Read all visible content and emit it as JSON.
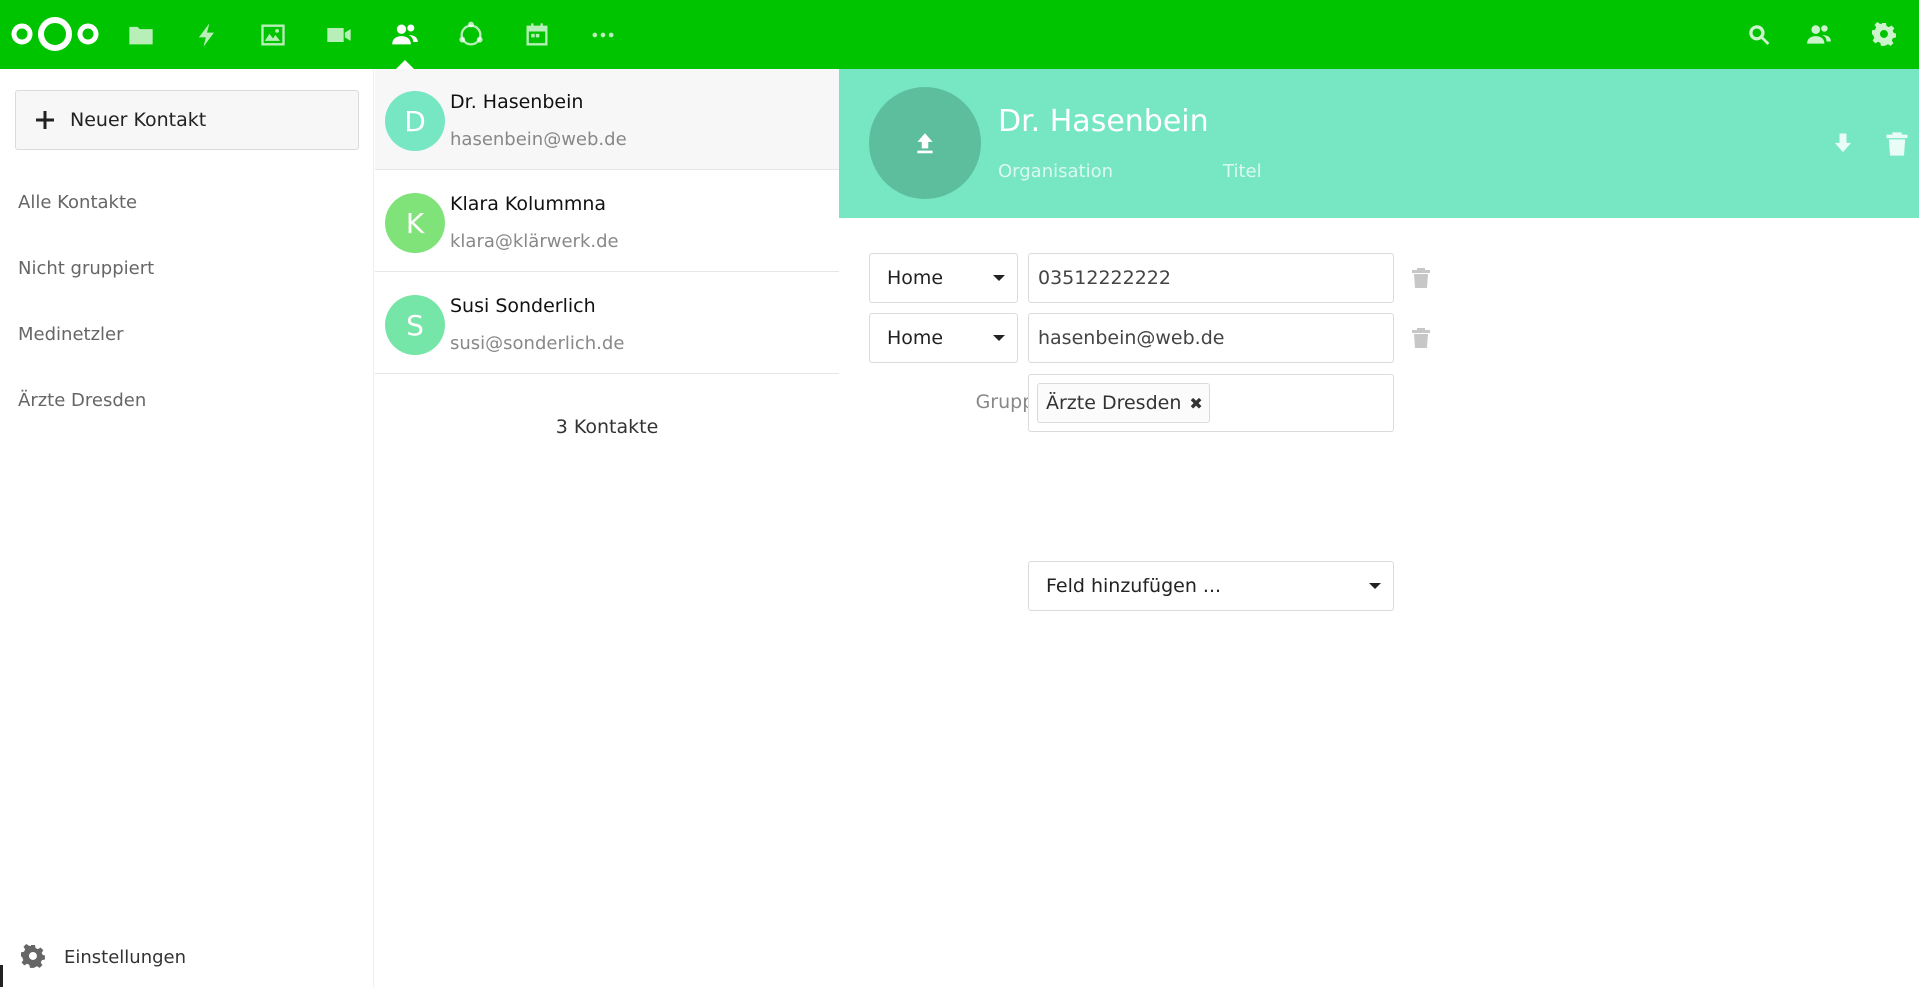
{
  "header": {
    "apps": [
      {
        "name": "files"
      },
      {
        "name": "activity"
      },
      {
        "name": "gallery"
      },
      {
        "name": "talk"
      },
      {
        "name": "contacts",
        "active": true
      },
      {
        "name": "circles"
      },
      {
        "name": "calendar"
      },
      {
        "name": "more"
      }
    ],
    "accent_color": "#00c400"
  },
  "navigation": {
    "new_contact_label": "Neuer Kontakt",
    "items": [
      {
        "label": "Alle Kontakte"
      },
      {
        "label": "Nicht gruppiert"
      },
      {
        "label": "Medinetzler"
      },
      {
        "label": "Ärzte Dresden"
      }
    ],
    "settings_label": "Einstellungen"
  },
  "contacts": {
    "items": [
      {
        "initial": "D",
        "name": "Dr. Hasenbein",
        "email": "hasenbein@web.de",
        "color": "#76e6c3",
        "selected": true
      },
      {
        "initial": "K",
        "name": "Klara Kolummna",
        "email": "klara@klärwerk.de",
        "color": "#7fe37a"
      },
      {
        "initial": "S",
        "name": "Susi Sonderlich",
        "email": "susi@sonderlich.de",
        "color": "#76e6a8"
      }
    ],
    "count_label": "3 Kontakte"
  },
  "details": {
    "name": "Dr. Hasenbein",
    "organisation_placeholder": "Organisation",
    "title_placeholder": "Titel",
    "header_color": "#76e6c3",
    "fields": [
      {
        "type_label": "Home",
        "value": "03512222222"
      },
      {
        "type_label": "Home",
        "value": "hasenbein@web.de"
      }
    ],
    "groups_label": "Gruppen",
    "group_chip": "Ärzte Dresden",
    "add_field_label": "Feld hinzufügen ..."
  }
}
